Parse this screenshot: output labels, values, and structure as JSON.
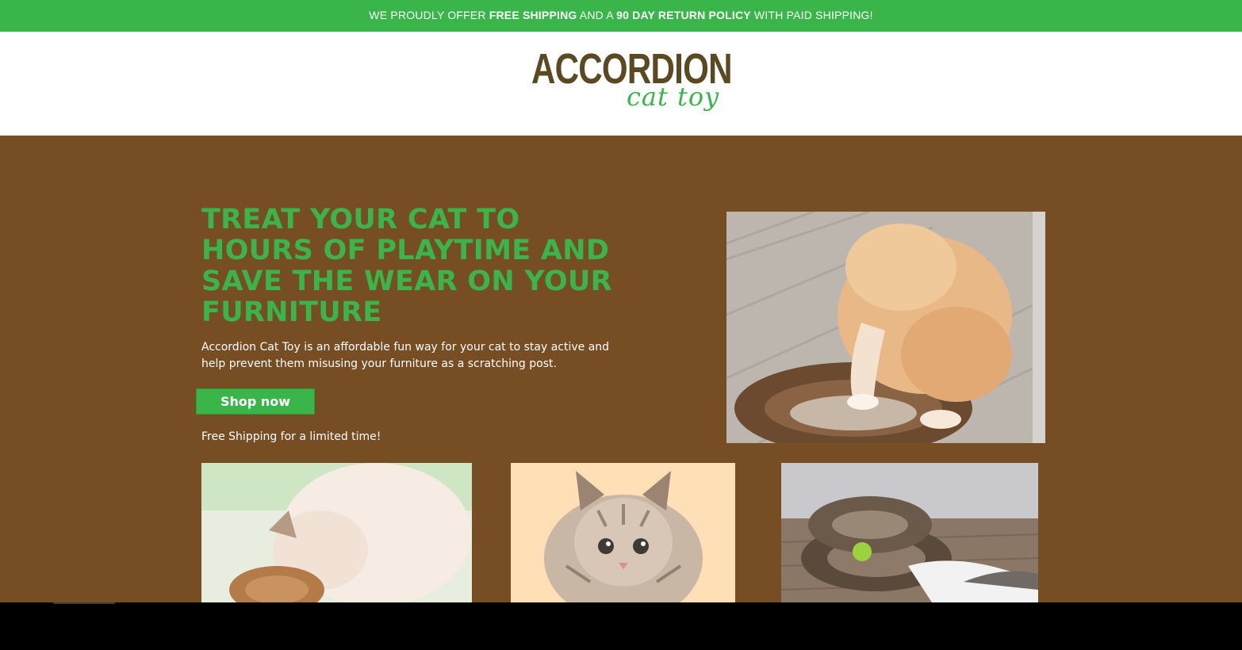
{
  "announcement": {
    "part1": "WE PROUDLY OFFER ",
    "bold1": "FREE SHIPPING",
    "part2": " AND A ",
    "bold2": "90 DAY RETURN POLICY",
    "part3": " WITH PAID SHIPPING!"
  },
  "logo": {
    "main": "ACCORDION",
    "sub": "cat toy"
  },
  "hero": {
    "headline": "TREAT YOUR CAT TO HOURS OF PLAYTIME AND SAVE THE WEAR ON YOUR FURNITURE",
    "description": "Accordion Cat Toy is an affordable fun way for your cat to stay active and help prevent them misusing your furniture as a scratching post.",
    "cta_label": "Shop now",
    "note": "Free Shipping for a limited time!"
  },
  "colors": {
    "accent": "#3ab54a",
    "hero_bg": "#774d24",
    "logo_brown": "#5b4a21"
  }
}
